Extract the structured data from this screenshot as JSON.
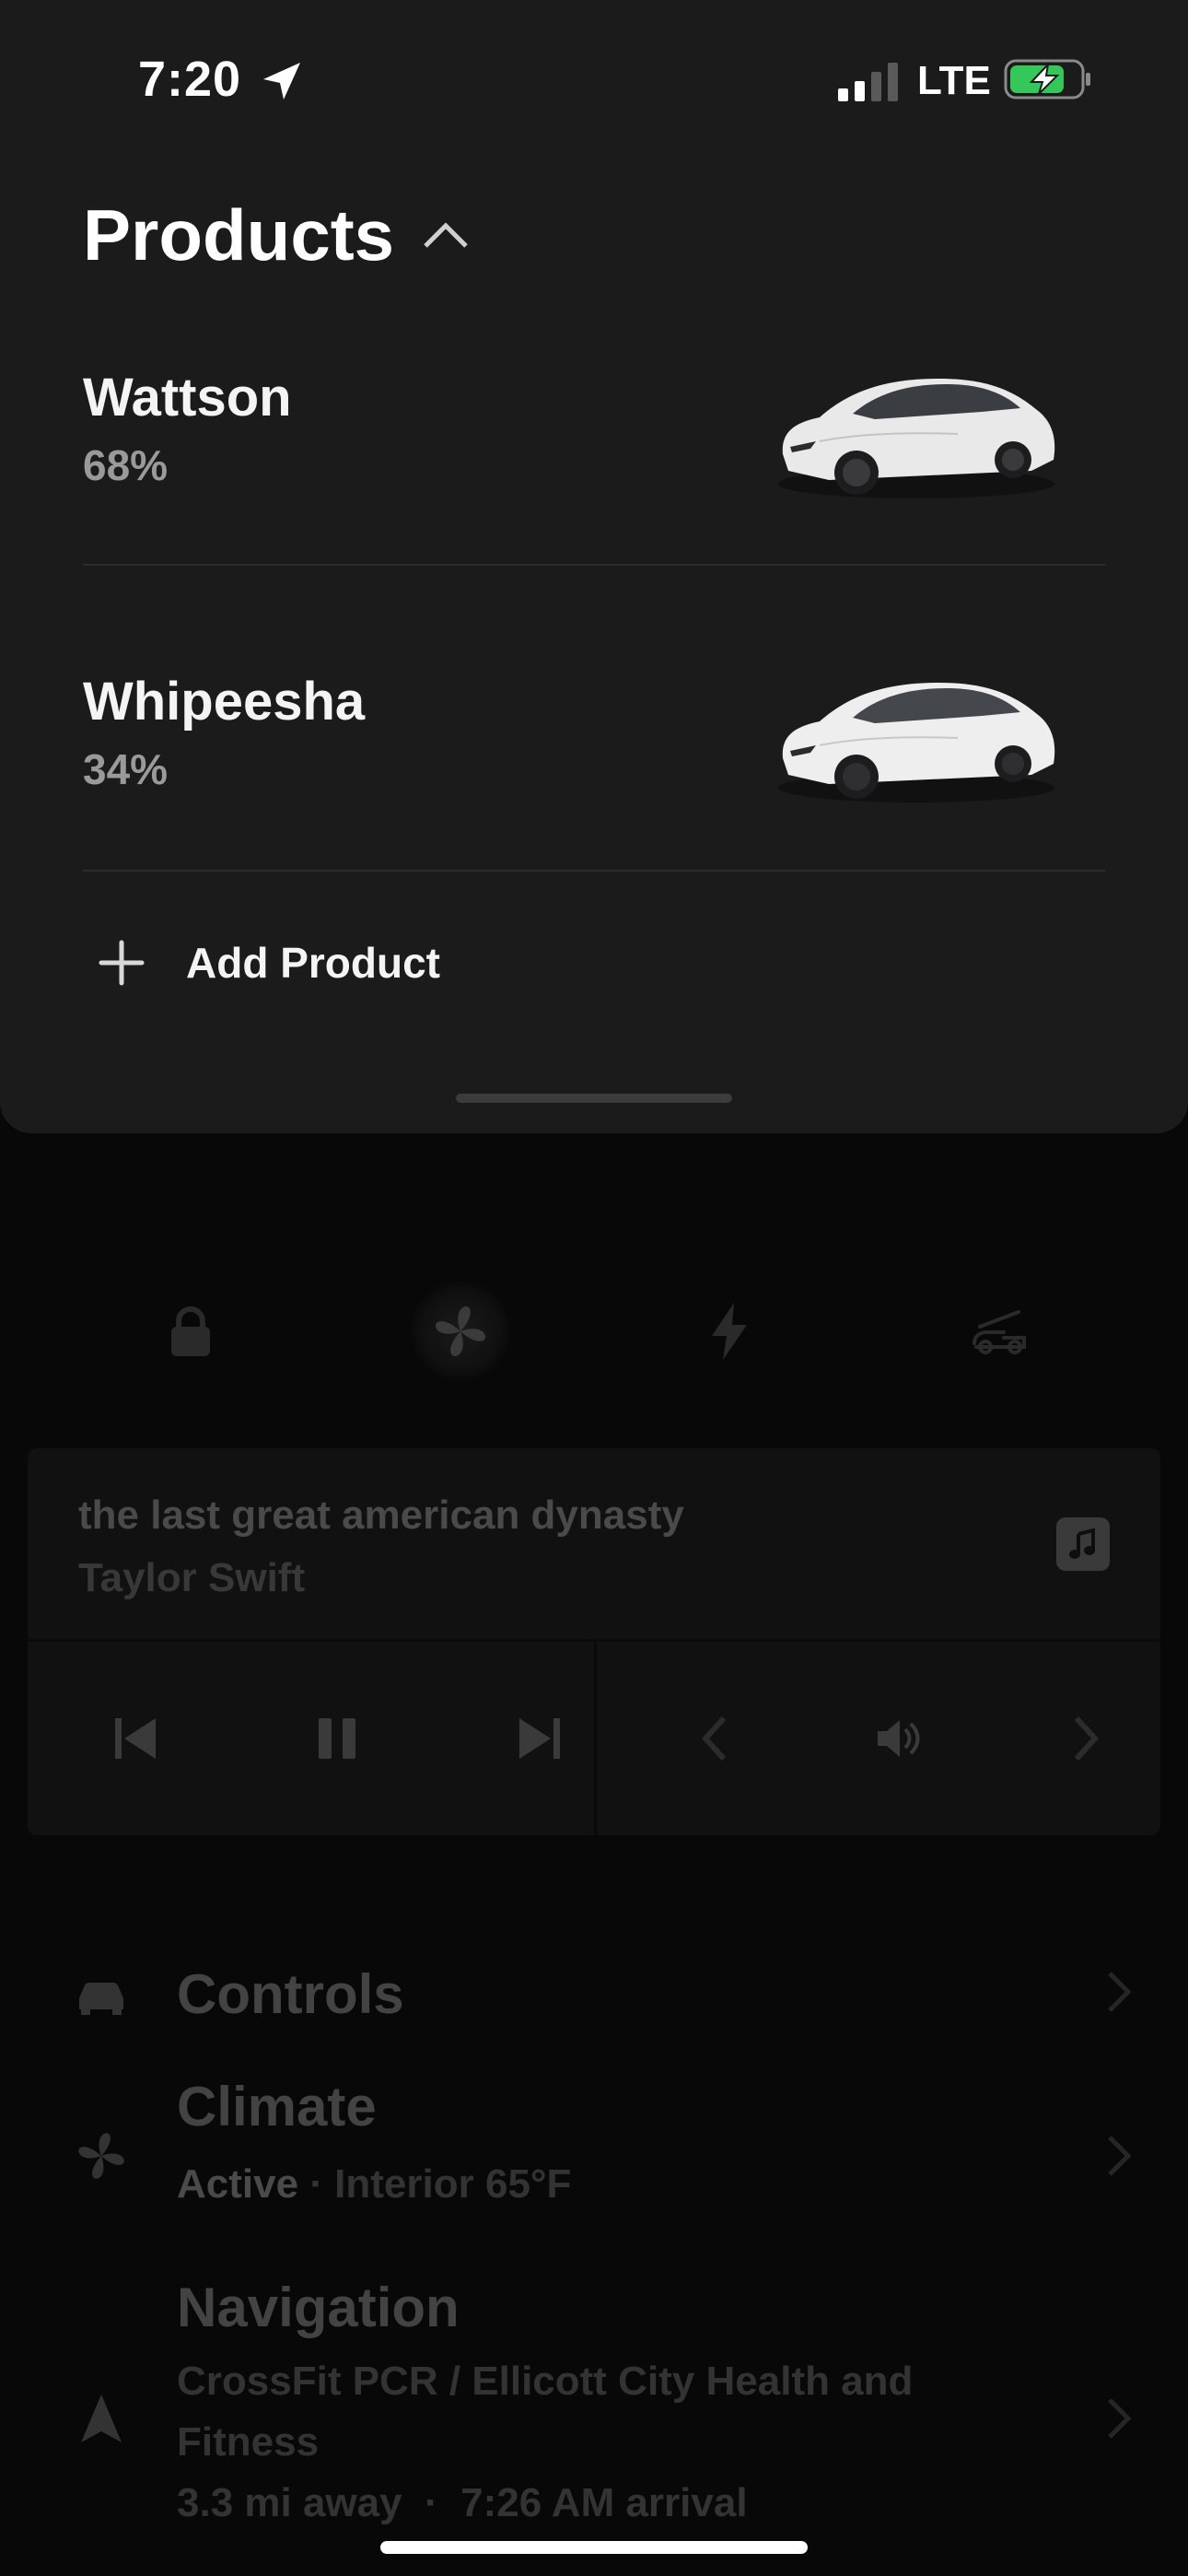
{
  "status_bar": {
    "time": "7:20",
    "network": "LTE",
    "location_icon": "location-arrow-icon",
    "signal_icon": "cellular-signal-icon",
    "battery_icon": "battery-charging-icon",
    "battery_color": "#34c759"
  },
  "products_sheet": {
    "title": "Products",
    "toggle_icon": "chevron-up-icon",
    "products": [
      {
        "name": "Wattson",
        "battery": "68%",
        "image": "white-suv-image"
      },
      {
        "name": "Whipeesha",
        "battery": "34%",
        "image": "white-suv-image"
      }
    ],
    "add_product_label": "Add Product",
    "add_icon": "plus-icon"
  },
  "quick_actions": [
    {
      "icon": "lock-icon",
      "active": false
    },
    {
      "icon": "fan-icon",
      "active": true
    },
    {
      "icon": "lightning-icon",
      "active": false
    },
    {
      "icon": "frunk-icon",
      "active": false
    }
  ],
  "media": {
    "track": "the last great american dynasty",
    "artist": "Taylor Swift",
    "source_icon": "music-note-icon",
    "controls": [
      "previous-track-icon",
      "pause-icon",
      "next-track-icon",
      "chevron-left-icon",
      "volume-icon",
      "chevron-right-icon"
    ]
  },
  "menu": {
    "controls": {
      "title": "Controls",
      "icon": "car-icon"
    },
    "climate": {
      "title": "Climate",
      "status": "Active",
      "detail": " · Interior 65°F",
      "icon": "fan-icon"
    },
    "navigation": {
      "title": "Navigation",
      "destination_line1": "CrossFit PCR / Ellicott City Health and",
      "destination_line2": "Fitness",
      "eta": "3.3 mi away  ·  7:26 AM arrival",
      "icon": "navigation-arrow-icon"
    }
  },
  "colors": {
    "sheet_bg": "#1b1b1c",
    "app_bg": "#080808",
    "accent_battery": "#34c759"
  }
}
